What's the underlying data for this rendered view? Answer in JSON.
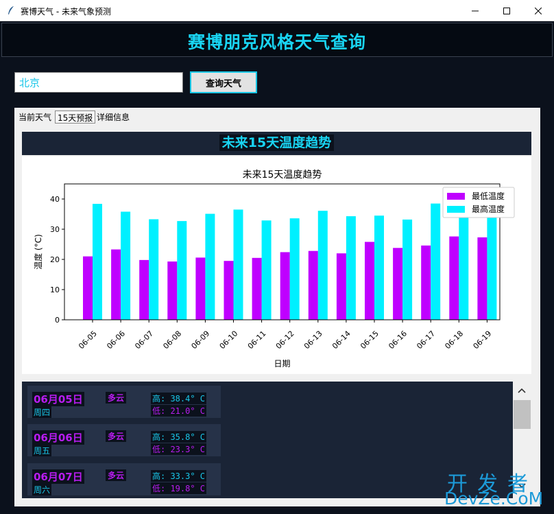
{
  "window": {
    "title": "赛博天气 - 未来气象预测"
  },
  "header": {
    "title": "赛博朋克风格天气查询"
  },
  "search": {
    "value": "北京",
    "button_label": "查询天气"
  },
  "tabs": [
    {
      "label": "当前天气"
    },
    {
      "label": "15天预报"
    },
    {
      "label": "详细信息"
    }
  ],
  "forecast": {
    "banner_title": "未来15天温度趋势"
  },
  "chart_data": {
    "type": "bar",
    "title": "未来15天温度趋势",
    "xlabel": "日期",
    "ylabel": "温度 (°C)",
    "categories": [
      "06-05",
      "06-06",
      "06-07",
      "06-08",
      "06-09",
      "06-10",
      "06-11",
      "06-12",
      "06-13",
      "06-14",
      "06-15",
      "06-16",
      "06-17",
      "06-18",
      "06-19"
    ],
    "series": [
      {
        "name": "最低温度",
        "color": "#bf00ff",
        "values": [
          21.0,
          23.3,
          19.8,
          19.3,
          20.6,
          19.5,
          20.5,
          22.4,
          22.8,
          22.0,
          25.8,
          23.8,
          24.6,
          27.6,
          27.3
        ]
      },
      {
        "name": "最高温度",
        "color": "#00f0ff",
        "values": [
          38.4,
          35.8,
          33.3,
          32.7,
          35.1,
          36.5,
          32.9,
          33.6,
          36.1,
          34.3,
          34.5,
          33.2,
          38.5,
          35.0,
          36.0
        ]
      }
    ],
    "ylim": [
      0,
      45
    ],
    "yticks": [
      0,
      10,
      20,
      30,
      40
    ],
    "legend": "top-right",
    "grid": false
  },
  "daily": [
    {
      "date": "06月05日",
      "weekday": "周四",
      "condition": "多云",
      "high": "高: 38.4° C",
      "low": "低: 21.0° C"
    },
    {
      "date": "06月06日",
      "weekday": "周五",
      "condition": "多云",
      "high": "高: 35.8° C",
      "low": "低: 23.3° C"
    },
    {
      "date": "06月07日",
      "weekday": "周六",
      "condition": "多云",
      "high": "高: 33.3° C",
      "low": "低: 19.8° C"
    }
  ],
  "watermark": {
    "cn": "开发者",
    "en": "DevZe.CoM"
  },
  "colors": {
    "accent": "#19d4f2",
    "purple": "#b81cf0",
    "panel": "#1a2436"
  }
}
